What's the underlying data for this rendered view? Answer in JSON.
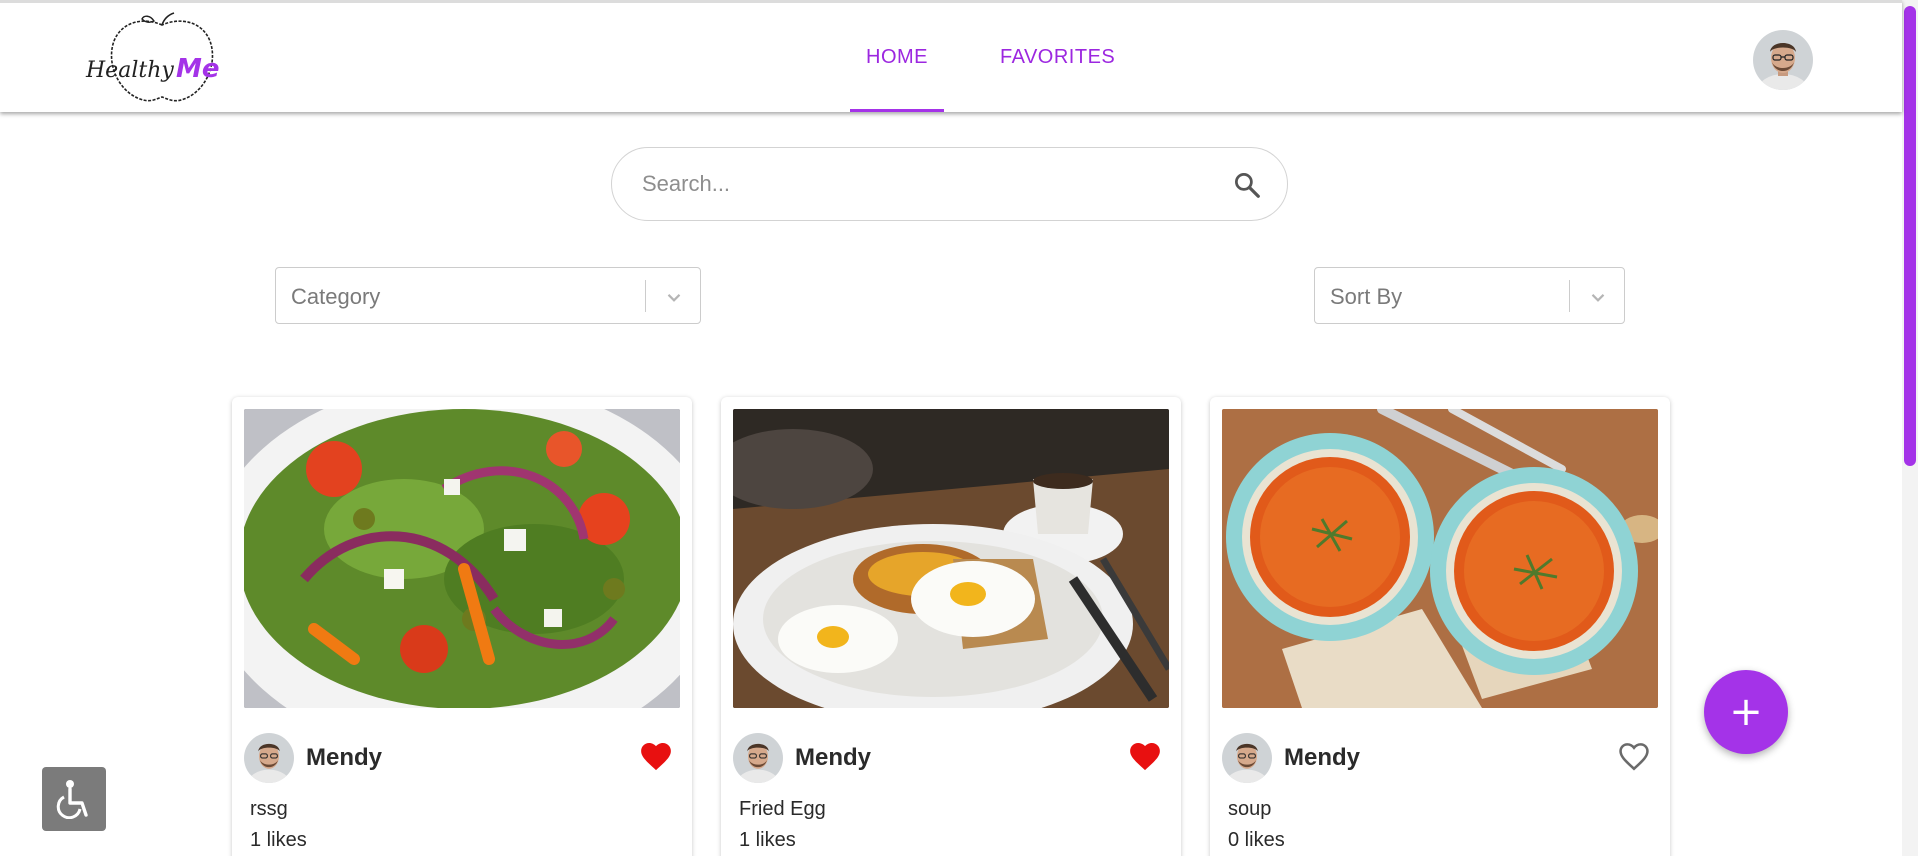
{
  "header": {
    "logo_text": "HealthyMe",
    "nav": [
      {
        "label": "HOME",
        "active": true
      },
      {
        "label": "FAVORITES",
        "active": false
      }
    ],
    "user_avatar": "user-avatar"
  },
  "search": {
    "placeholder": "Search...",
    "icon": "search-icon"
  },
  "filters": {
    "category_placeholder": "Category",
    "sort_placeholder": "Sort By"
  },
  "cards": [
    {
      "author": "Mendy",
      "title": "rssg",
      "likes": "1 likes",
      "liked": true,
      "image": "salad"
    },
    {
      "author": "Mendy",
      "title": "Fried Egg",
      "likes": "1 likes",
      "liked": true,
      "image": "fried-egg"
    },
    {
      "author": "Mendy",
      "title": "soup",
      "likes": "0 likes",
      "liked": false,
      "image": "soup"
    }
  ],
  "fab": {
    "label": "+"
  },
  "colors": {
    "accent": "#a433e8",
    "heart": "#e81010",
    "text": "#2a2a2a"
  }
}
